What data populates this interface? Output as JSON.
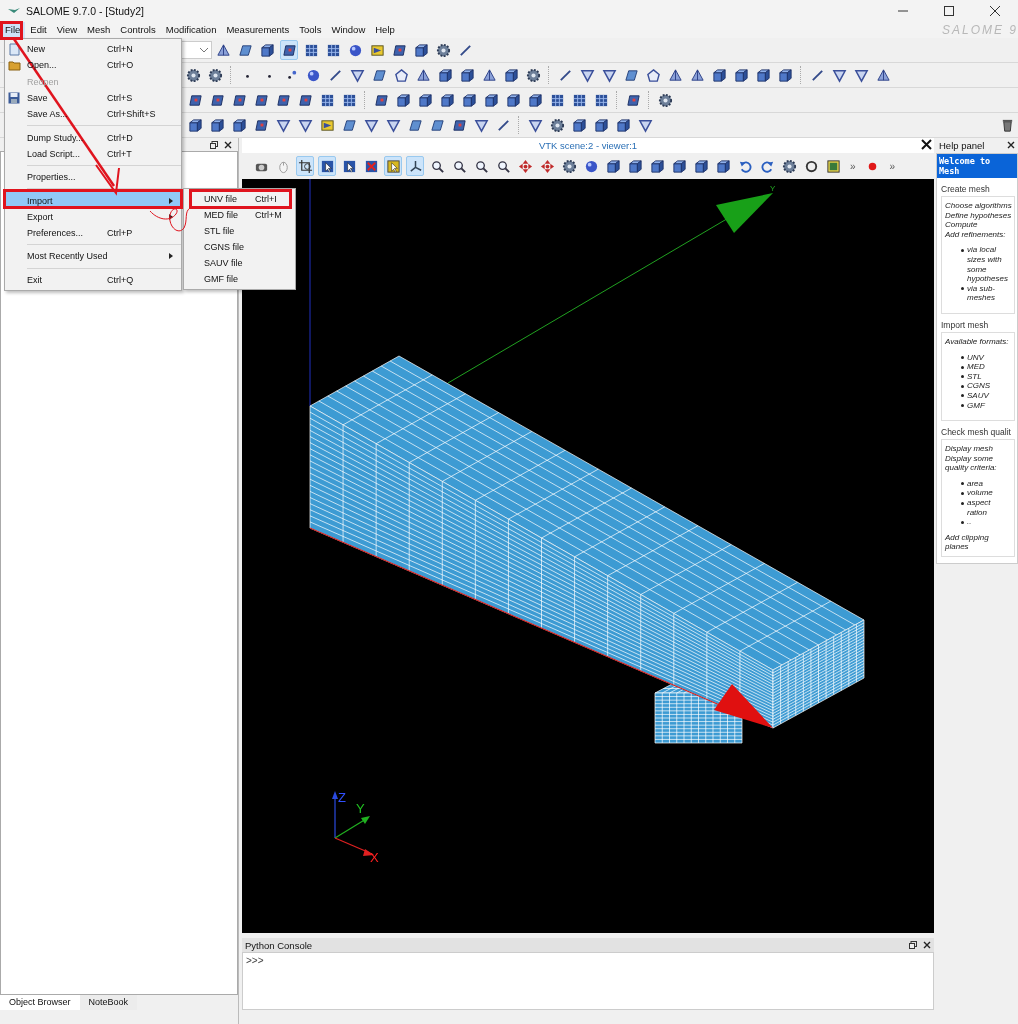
{
  "window": {
    "title": "SALOME 9.7.0 - [Study2]",
    "logo": "SALOME 9"
  },
  "menu_bar": [
    {
      "label": "File",
      "selected": true
    },
    {
      "label": "Edit",
      "selected": false
    },
    {
      "label": "View",
      "selected": false
    },
    {
      "label": "Mesh",
      "selected": false
    },
    {
      "label": "Controls",
      "selected": false
    },
    {
      "label": "Modification",
      "selected": false
    },
    {
      "label": "Measurements",
      "selected": false
    },
    {
      "label": "Tools",
      "selected": false
    },
    {
      "label": "Window",
      "selected": false
    },
    {
      "label": "Help",
      "selected": false
    }
  ],
  "main_toolbar": [
    {
      "selected": false
    },
    {
      "selected": false
    },
    {
      "selected": false
    },
    {
      "selected": true
    },
    {
      "selected": false
    },
    {
      "selected": false
    },
    {
      "selected": false
    },
    {
      "selected": false
    },
    {
      "selected": false
    },
    {
      "selected": false
    },
    {
      "selected": false
    },
    {
      "selected": false
    }
  ],
  "file_menu": [
    {
      "kind": "item",
      "label": "New",
      "shortcut": "Ctrl+N",
      "has_icon": true,
      "disabled": false,
      "submenu": false,
      "selected": false
    },
    {
      "kind": "item",
      "label": "Open...",
      "shortcut": "Ctrl+O",
      "has_icon": true,
      "disabled": false,
      "submenu": false,
      "selected": false
    },
    {
      "kind": "item",
      "label": "Reopen",
      "has_icon": false,
      "disabled": true,
      "submenu": false,
      "selected": false
    },
    {
      "kind": "item",
      "label": "Save",
      "shortcut": "Ctrl+S",
      "has_icon": true,
      "disabled": false,
      "submenu": false,
      "selected": false
    },
    {
      "kind": "item",
      "label": "Save As...",
      "shortcut": "Ctrl+Shift+S",
      "has_icon": false,
      "disabled": false,
      "submenu": false,
      "selected": false
    },
    {
      "kind": "separator"
    },
    {
      "kind": "item",
      "label": "Dump Study...",
      "shortcut": "Ctrl+D",
      "has_icon": false,
      "disabled": false,
      "submenu": false,
      "selected": false
    },
    {
      "kind": "item",
      "label": "Load Script...",
      "shortcut": "Ctrl+T",
      "has_icon": false,
      "disabled": false,
      "submenu": false,
      "selected": false
    },
    {
      "kind": "separator"
    },
    {
      "kind": "item",
      "label": "Properties...",
      "has_icon": false,
      "disabled": false,
      "submenu": false,
      "selected": false
    },
    {
      "kind": "separator"
    },
    {
      "kind": "item",
      "label": "Import",
      "has_icon": false,
      "disabled": false,
      "submenu": true,
      "selected": true
    },
    {
      "kind": "item",
      "label": "Export",
      "has_icon": false,
      "disabled": false,
      "submenu": true,
      "selected": false
    },
    {
      "kind": "item",
      "label": "Preferences...",
      "shortcut": "Ctrl+P",
      "has_icon": false,
      "disabled": false,
      "submenu": false,
      "selected": false
    },
    {
      "kind": "separator"
    },
    {
      "kind": "item",
      "label": "Most Recently Used",
      "has_icon": false,
      "disabled": false,
      "submenu": true,
      "selected": false
    },
    {
      "kind": "separator"
    },
    {
      "kind": "item",
      "label": "Exit",
      "shortcut": "Ctrl+Q",
      "has_icon": false,
      "disabled": false,
      "submenu": false,
      "selected": false
    }
  ],
  "import_submenu": [
    {
      "label": "UNV file",
      "shortcut": "Ctrl+I",
      "selected": false
    },
    {
      "label": "MED file",
      "shortcut": "Ctrl+M",
      "selected": false
    },
    {
      "label": "STL file",
      "selected": false
    },
    {
      "label": "CGNS file",
      "selected": false
    },
    {
      "label": "SAUV file",
      "selected": false
    },
    {
      "label": "GMF file",
      "selected": false
    }
  ],
  "viewer": {
    "title": "VTK scene:2 - viewer:1",
    "toolbar": [
      {
        "selected": false
      },
      {
        "selected": false
      },
      {
        "selected": true
      },
      {
        "selected": true
      },
      {
        "selected": false
      },
      {
        "selected": false
      },
      {
        "selected": true
      },
      {
        "selected": true
      },
      {
        "selected": false
      },
      {
        "selected": false
      },
      {
        "selected": false
      },
      {
        "selected": false
      },
      {
        "selected": false
      },
      {
        "selected": false
      },
      {
        "selected": false
      },
      {
        "selected": false
      },
      {
        "selected": false
      },
      {
        "selected": false
      },
      {
        "selected": false
      },
      {
        "selected": false
      },
      {
        "selected": false
      },
      {
        "selected": false
      },
      {
        "selected": false
      },
      {
        "selected": false
      },
      {
        "selected": false
      },
      {
        "selected": false
      },
      {
        "selected": false
      }
    ],
    "overflow": [
      "»",
      "»"
    ],
    "arrow_label": "Y",
    "axis_labels": [
      "Z",
      "Y",
      "X"
    ]
  },
  "help_panel": {
    "title": "Help panel",
    "heading": "Welcome to Mesh",
    "sections": [
      {
        "title": "Create mesh",
        "lines": [
          "Choose algorithms",
          "Define hypotheses",
          "Compute",
          "Add refinements:"
        ],
        "bullets": [
          "via local sizes with some hypotheses",
          "via sub-meshes"
        ]
      },
      {
        "title": "Import mesh",
        "lines": [
          "Available formats:"
        ],
        "bullets": [
          "UNV",
          "MED",
          "STL",
          "CGNS",
          "SAUV",
          "GMF"
        ]
      },
      {
        "title": "Check mesh qualit",
        "lines": [
          "Display mesh",
          "Display some quality criteria:"
        ],
        "bullets": [
          "area",
          "volume",
          "aspect ration",
          ".."
        ],
        "footer": "Add clipping planes"
      }
    ]
  },
  "python_console": {
    "title": "Python Console",
    "prompt": ">>>"
  },
  "dock_tabs": [
    {
      "label": "Object Browser",
      "selected": true
    },
    {
      "label": "NoteBook",
      "selected": false
    }
  ]
}
